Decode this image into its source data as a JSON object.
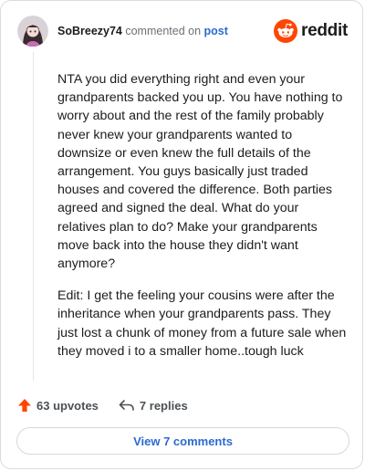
{
  "header": {
    "author": "SoBreezy74",
    "verb": "commented on",
    "post_link": "post",
    "brand": "reddit"
  },
  "comment": {
    "paragraphs": [
      "NTA you did everything right and even your grandparents backed you up. You have nothing to worry about and the rest of the family probably never knew your grandparents wanted to downsize or even knew the full details of the arrangement. You guys basically just traded houses and covered the difference. Both parties agreed and signed the deal. What do your relatives plan to do? Make your grandparents move back into the house they didn't want anymore?",
      "Edit: I get the feeling your cousins were after the inheritance when your grandparents pass. They just lost a chunk of money from a future sale when they moved i to a smaller home..tough luck"
    ]
  },
  "actions": {
    "upvotes": "63 upvotes",
    "replies": "7 replies",
    "view_comments": "View 7 comments"
  },
  "colors": {
    "brand_orange": "#ff4500",
    "link_blue": "#2a6bd1"
  }
}
